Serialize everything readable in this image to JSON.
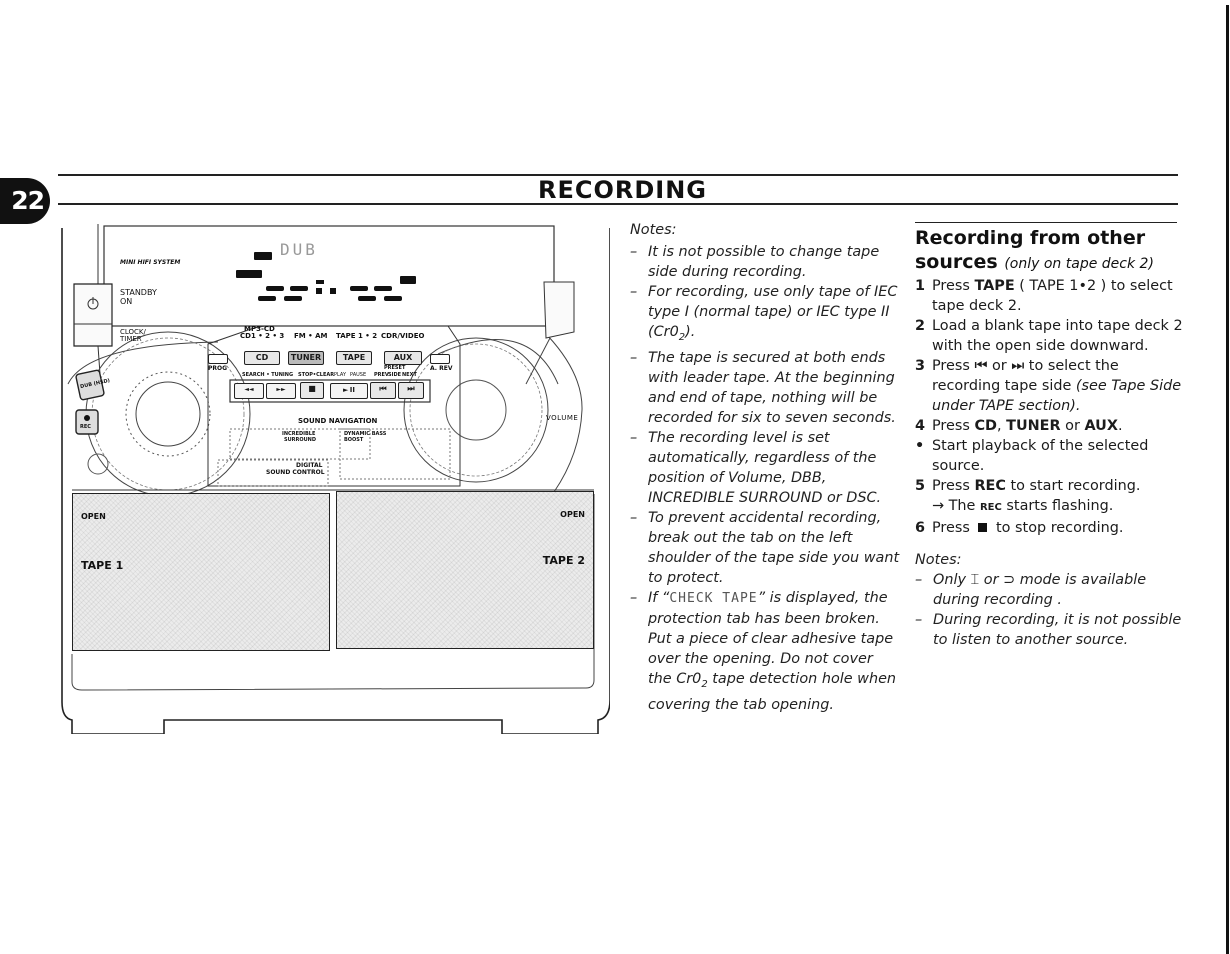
{
  "header": {
    "page_number": "22",
    "section_title": "RECORDING"
  },
  "notes_column": {
    "label": "Notes:",
    "items": [
      "It is not possible to change tape side during recording.",
      "For recording, use only tape of IEC type I (normal tape) or IEC type II (Cr0",
      "The tape is secured at both ends with leader tape. At the beginning and end of tape, nothing will be recorded for six to seven seconds.",
      "The recording level is set automatically, regardless of the position of Volume, DBB, INCREDIBLE SURROUND or DSC.",
      "To prevent accidental recording, break out the tab on the left shoulder of the tape side you want to protect."
    ],
    "item2_tail": ").",
    "item2_subscript": "2",
    "item6": {
      "pre": "If “",
      "display_text": "CHECK TAPE",
      "mid": "” is displayed, the protection tab has been broken.  Put a piece of clear adhesive tape over the opening.  Do not cover the Cr0",
      "subscript": "2",
      "post": " tape detection hole when covering the tab opening."
    },
    "dash": "–"
  },
  "steps_column": {
    "title": "Recording from other sources",
    "title_note": "(only on tape deck 2)",
    "steps": [
      {
        "num": "1",
        "pre": "Press ",
        "bold": "TAPE",
        "post": " ( TAPE 1•2 ) to select tape deck 2."
      },
      {
        "num": "2",
        "text": "Load a blank tape into tape deck 2 with the open side downward."
      },
      {
        "num": "3",
        "pre": "Press ",
        "icon1": "⏮",
        "mid": " or ",
        "icon2": "⏭",
        "post": " to select the recording tape side ",
        "italic": "(see Tape Side under TAPE section)."
      },
      {
        "num": "4",
        "pre": "Press ",
        "bold1": "CD",
        "sep": ", ",
        "bold2": "TUNER",
        "or": " or ",
        "bold3": "AUX",
        "end": "."
      },
      {
        "num": "•",
        "text": "Start playback of the selected source."
      },
      {
        "num": "5",
        "pre": "Press ",
        "bold": "REC",
        "post": " to start recording."
      },
      {
        "num": "",
        "arrow": "→",
        "pre": " The ",
        "smallcaps": "REC",
        "post": " starts flashing."
      },
      {
        "num": "6",
        "pre": "Press ",
        "post": " to stop recording."
      }
    ],
    "notes_label": "Notes:",
    "notes": [
      {
        "pre": "Only ",
        "icon1": "⌶",
        "mid": " or ",
        "icon2": "⊃",
        "post": " mode is available during recording ."
      },
      {
        "text": "During recording, it is not possible to listen to another source."
      }
    ]
  },
  "device": {
    "brand_label": "MINI HIFI SYSTEM",
    "standby_label": "STANDBY",
    "on_label": "ON",
    "clock_label": "CLOCK/",
    "timer_label": "TIMER",
    "display_text": "DUB",
    "source_labels": [
      "MP3-CD",
      "CD1 • 2 • 3",
      "FM • AM",
      "TAPE 1 • 2",
      "CDR/VIDEO"
    ],
    "source_buttons": [
      "CD",
      "TUNER",
      "TAPE",
      "AUX"
    ],
    "prog_label": "PROG",
    "arev_label": "A. REV",
    "control_labels": [
      "SEARCH • TUNING",
      "STOP•CLEAR",
      "PLAY",
      "PAUSE",
      "PREV",
      "SIDE",
      "NEXT",
      "PRESET"
    ],
    "transport_buttons": [
      "◄◄",
      "►►",
      "■",
      "► II",
      "⏮",
      "⏭"
    ],
    "sound_navigation": "SOUND NAVIGATION",
    "incredible_surround": [
      "INCREDIBLE",
      "SURROUND"
    ],
    "dynamic_bass": [
      "DYNAMIC BASS",
      "BOOST"
    ],
    "digital_sound": [
      "DIGITAL",
      "SOUND CONTROL"
    ],
    "dub_label": "DUB (HSD)",
    "rec_label": "REC",
    "volume_label": "VOLUME",
    "tape1_label": "TAPE 1",
    "tape2_label": "TAPE 2",
    "open_label": "OPEN"
  }
}
